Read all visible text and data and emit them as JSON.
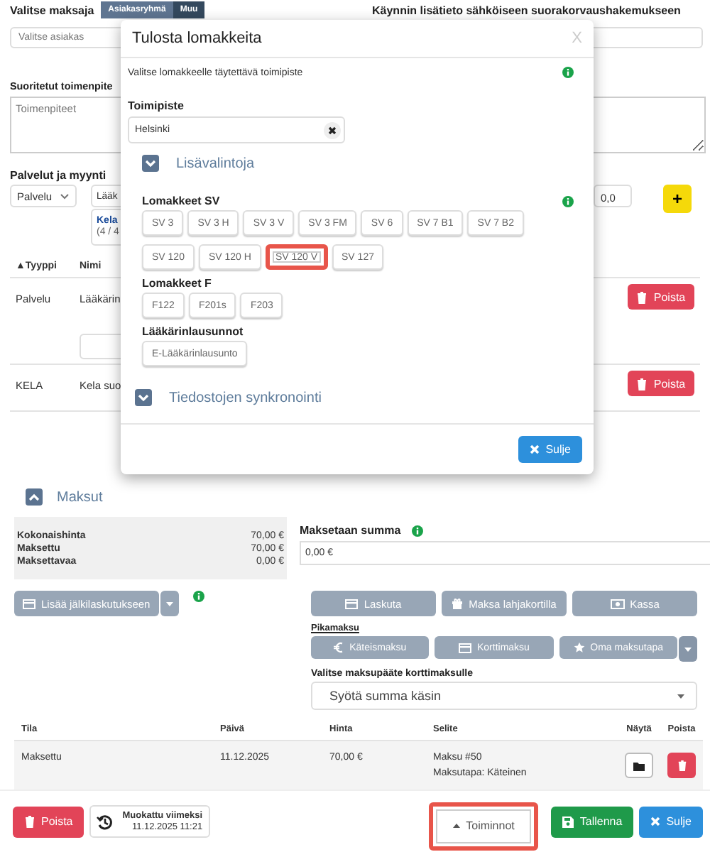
{
  "payer": {
    "label": "Valitse maksaja",
    "options": [
      {
        "label": "Asiakasryhmä",
        "selected": true
      },
      {
        "label": "Muu",
        "selected": false
      }
    ],
    "placeholder": "Valitse asiakas"
  },
  "visit_info": {
    "label": "Käynnin lisätieto sähköiseen suorakorvaushakemukseen"
  },
  "procedures": {
    "label": "Suoritetut toimenpite",
    "placeholder": "Toimenpiteet"
  },
  "services": {
    "label": "Palvelut ja myynti",
    "type_select": "Palvelu",
    "name_value": "Lääk",
    "kela_title": "Kela",
    "kela_count": "(4 / 4",
    "vat_value": "0,0",
    "add_button": "+",
    "table": {
      "columns": [
        "▲Tyyppi",
        "Nimi"
      ],
      "rows": [
        {
          "type": "Palvelu",
          "name": "Lääkärin",
          "has_field": true,
          "action": "Poista"
        },
        {
          "type": "KELA",
          "name": "Kela suo",
          "has_field": false,
          "action": "Poista"
        }
      ]
    }
  },
  "modal": {
    "title": "Tulosta lomakkeita",
    "close": "X",
    "hint": "Valitse lomakkeelle täytettävä toimipiste",
    "office_label": "Toimipiste",
    "office_value": "Helsinki",
    "options_toggle": {
      "title": "Lisävalintoja",
      "expanded": false
    },
    "groups": [
      {
        "title": "Lomakkeet SV",
        "info": true,
        "forms": [
          {
            "label": "SV 3",
            "highlighted": false
          },
          {
            "label": "SV 3 H",
            "highlighted": false
          },
          {
            "label": "SV 3 V",
            "highlighted": false
          },
          {
            "label": "SV 3 FM",
            "highlighted": false
          },
          {
            "label": "SV 6",
            "highlighted": false
          },
          {
            "label": "SV 7 B1",
            "highlighted": false
          },
          {
            "label": "SV 7 B2",
            "highlighted": false
          },
          {
            "label": "SV 120",
            "highlighted": false
          },
          {
            "label": "SV 120 H",
            "highlighted": false
          },
          {
            "label": "SV 120 V",
            "highlighted": true
          },
          {
            "label": "SV 127",
            "highlighted": false
          }
        ]
      },
      {
        "title": "Lomakkeet F",
        "info": false,
        "forms": [
          {
            "label": "F122",
            "highlighted": false
          },
          {
            "label": "F201s",
            "highlighted": false
          },
          {
            "label": "F203",
            "highlighted": false
          }
        ]
      },
      {
        "title": "Lääkärinlausunnot",
        "info": false,
        "forms": [
          {
            "label": "E-Lääkärinlausunto",
            "highlighted": false
          }
        ]
      }
    ],
    "sync_toggle": {
      "title": "Tiedostojen synkronointi",
      "expanded": false
    },
    "close_button": "Sulje"
  },
  "payments": {
    "title": "Maksut",
    "expanded": true,
    "summary": [
      {
        "label": "Kokonaishinta",
        "value": "70,00 €"
      },
      {
        "label": "Maksettu",
        "value": "70,00 €"
      },
      {
        "label": "Maksettavaa",
        "value": "0,00 €"
      }
    ],
    "amount_label": "Maksetaan summa",
    "amount_value": "0,00 €",
    "deferred_button": "Lisää jälkilaskutukseen",
    "actions": [
      {
        "label": "Laskuta",
        "kind": "invoice"
      },
      {
        "label": "Maksa lahjakortilla",
        "kind": "gift"
      },
      {
        "label": "Kassa",
        "kind": "cash"
      }
    ],
    "quick_label": "Pikamaksu",
    "quick_actions": [
      {
        "label": "Käteismaksu",
        "kind": "euro"
      },
      {
        "label": "Korttimaksu",
        "kind": "card"
      },
      {
        "label": "Oma maksutapa",
        "kind": "star"
      }
    ],
    "terminal_label": "Valitse maksupääte korttimaksulle",
    "terminal_value": "Syötä summa käsin",
    "table": {
      "columns": [
        "Tila",
        "Päivä",
        "Hinta",
        "Selite",
        "Näytä",
        "Poista"
      ],
      "rows": [
        {
          "status": "Maksettu",
          "date": "11.12.2025",
          "price": "70,00 €",
          "description": [
            "Maksu #50",
            "Maksutapa: Käteinen"
          ]
        }
      ]
    }
  },
  "footer": {
    "delete": "Poista",
    "modified_label": "Muokattu viimeksi",
    "modified_at": "11.12.2025 11:21",
    "actions": [
      {
        "label": "Toiminnot",
        "kind": "menu",
        "highlighted": true
      },
      {
        "label": "Tallenna",
        "kind": "save",
        "highlighted": false
      },
      {
        "label": "Sulje",
        "kind": "close",
        "highlighted": false
      }
    ]
  }
}
